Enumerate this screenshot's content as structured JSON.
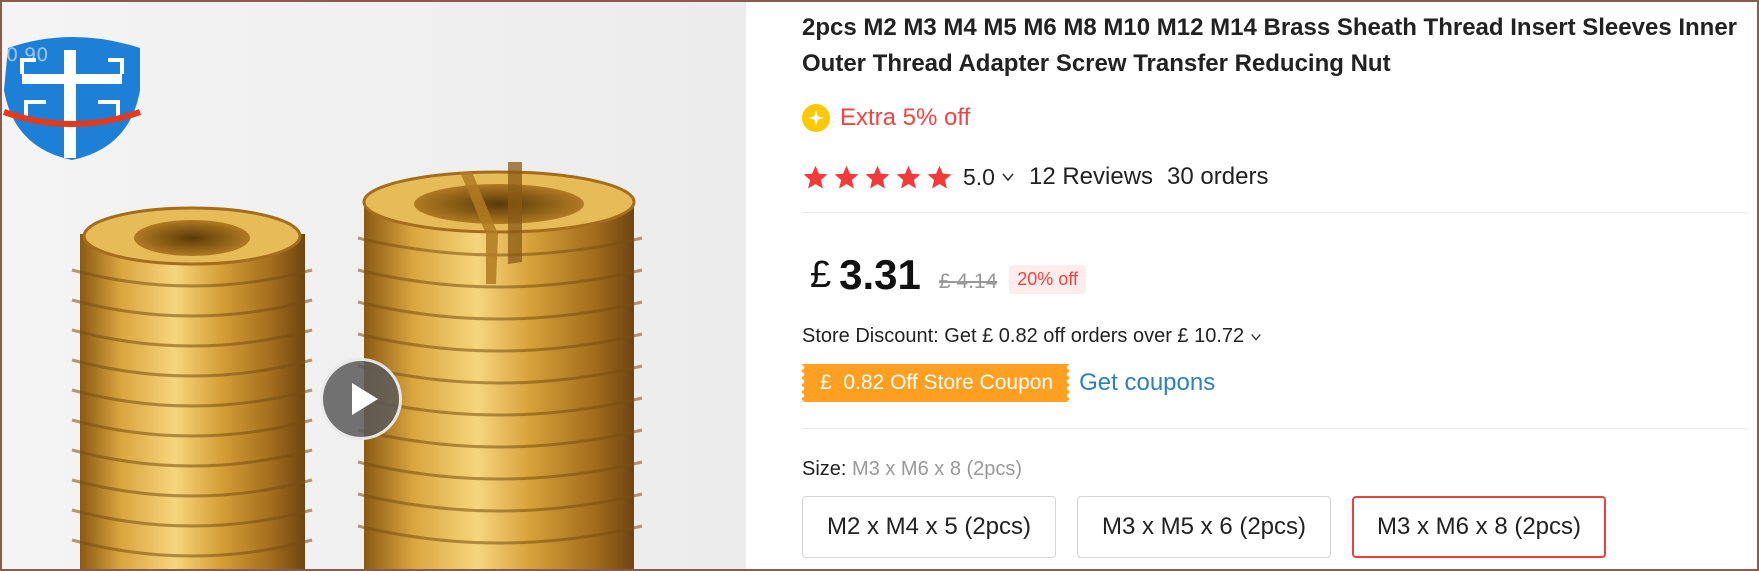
{
  "media": {
    "zoom_label": "0.90"
  },
  "product": {
    "title": "2pcs M2 M3 M4 M5 M6 M8 M10 M12 M14 Brass Sheath Thread Insert Sleeves Inner Outer Thread Adapter Screw Transfer Reducing Nut",
    "extra_offer": "Extra 5% off",
    "rating": {
      "stars": 5,
      "value": "5.0",
      "reviews": "12 Reviews",
      "orders": "30 orders"
    },
    "price": {
      "currency": "£",
      "current": "3.31",
      "original": "£ 4.14",
      "discount": "20% off"
    },
    "store_discount": {
      "prefix": "Store Discount: Get",
      "currency1": "£",
      "amount": "0.82 off orders over",
      "currency2": "£",
      "threshold": "10.72"
    },
    "coupon": {
      "currency": "£",
      "label": "0.82 Off Store Coupon",
      "get_label": "Get coupons"
    },
    "size": {
      "label": "Size:",
      "selected": "M3 x M6 x 8 (2pcs)",
      "options": [
        "M2 x M4 x 5 (2pcs)",
        "M3 x M5 x 6 (2pcs)",
        "M3 x M6 x 8 (2pcs)"
      ],
      "selected_index": 2
    }
  },
  "colors": {
    "accent_red": "#ef4444",
    "coupon_orange": "#ffa022",
    "link_blue": "#2f7fbf",
    "star_red": "#f13a3a",
    "brass": "#c9962e"
  }
}
